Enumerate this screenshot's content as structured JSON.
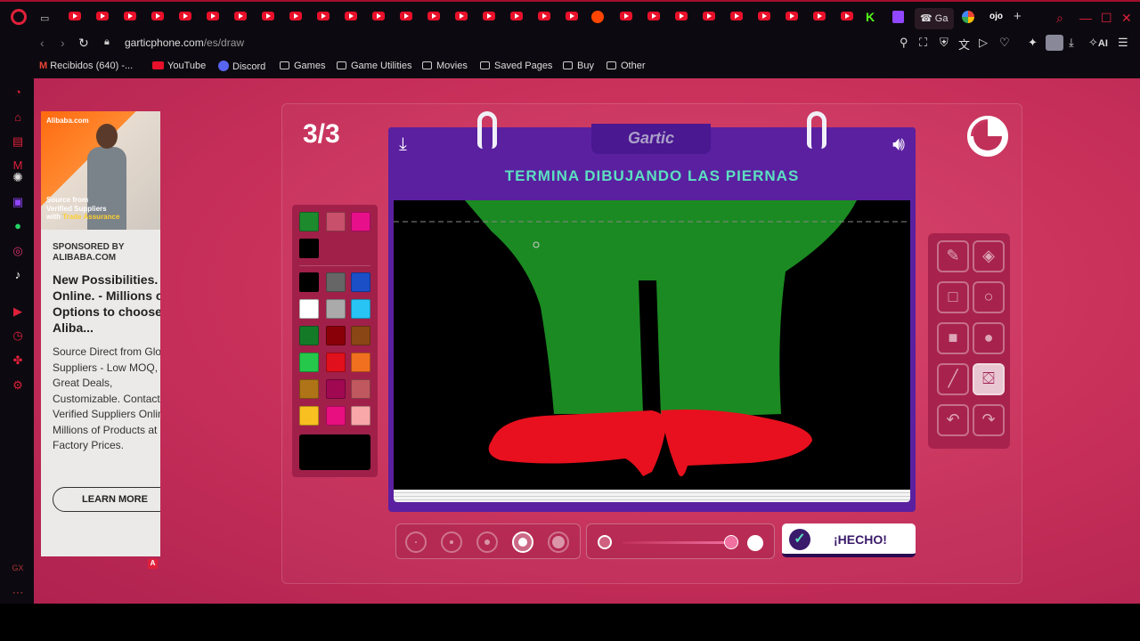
{
  "browser": {
    "active_tab_title": "Ga",
    "url_domain": "garticphone.com",
    "url_path": "/es/draw",
    "bookmarks": [
      "Recibidos (640) -...",
      "YouTube",
      "Discord",
      "Games",
      "Game Utilities",
      "Movies",
      "Saved Pages",
      "Buy",
      "Other"
    ],
    "ai_label": "AI"
  },
  "ad": {
    "brand": "Alibaba.com",
    "image_caption_1": "Source from",
    "image_caption_2": "Verified Suppliers",
    "image_caption_3a": "with",
    "image_caption_3b": "Trade Assurance",
    "sponsor": "SPONSORED BY ALIBABA.COM",
    "headline": "New Possibilities. All Online. - Millions of Options to choose - Aliba...",
    "body": "Source Direct from Global Suppliers - Low MOQ, Great Deals, Customizable. Contact Verified Suppliers Online. Millions of Products at Factory Prices.",
    "cta": "LEARN MORE",
    "choices_badge": "A"
  },
  "game": {
    "round": "3/3",
    "logo": "Gartic",
    "prompt": "TERMINA DIBUJANDO LAS PIERNAS",
    "done_label": "¡HECHO!",
    "opacity_fraction": 0.9,
    "selected_size_index": 3
  },
  "palette": {
    "recent": [
      "#1d8a2e",
      "#c8506a",
      "#e8108a",
      "#000000"
    ],
    "colors": [
      "#000000",
      "#666666",
      "#1a4fc8",
      "#ffffff",
      "#aaaaaa",
      "#27c4f4",
      "#157a28",
      "#8a0008",
      "#8a4614",
      "#25c84a",
      "#e0101c",
      "#f07020",
      "#b07418",
      "#a00852",
      "#c05860",
      "#f8c020",
      "#e81080",
      "#f8a8a8"
    ],
    "current": "#000000"
  },
  "tools": [
    "pencil-icon",
    "eraser-icon",
    "rectangle-outline-icon",
    "circle-outline-icon",
    "rectangle-fill-icon",
    "circle-fill-icon",
    "line-icon",
    "bucket-icon",
    "undo-icon",
    "redo-icon"
  ],
  "drawing_colors": {
    "legs": "#1b8a22",
    "shoes": "#e8101e",
    "background": "#000000"
  }
}
